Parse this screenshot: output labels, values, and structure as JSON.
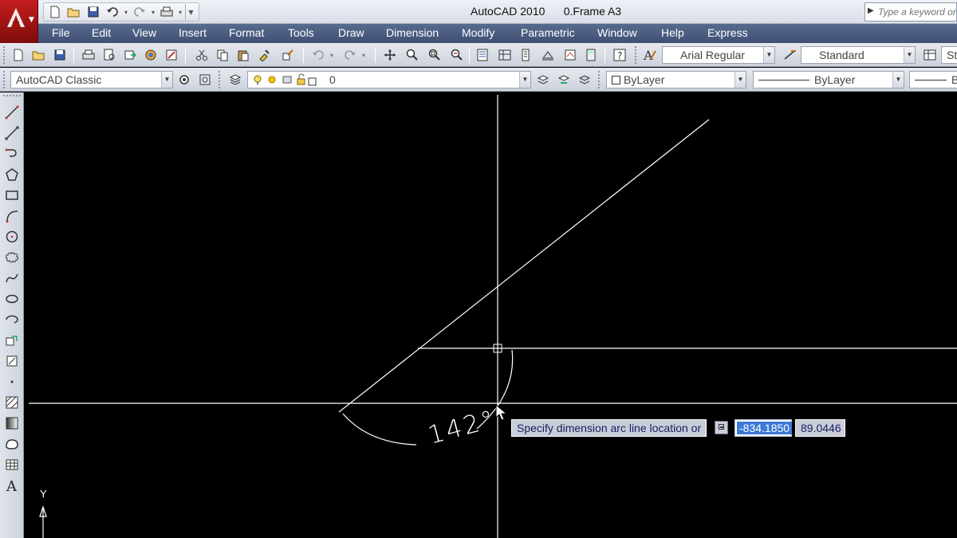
{
  "window": {
    "title": "AutoCAD 2010      0.Frame A3",
    "search_placeholder": "Type a keyword or phrase"
  },
  "menu": {
    "items": [
      "File",
      "Edit",
      "View",
      "Insert",
      "Format",
      "Tools",
      "Draw",
      "Dimension",
      "Modify",
      "Parametric",
      "Window",
      "Help",
      "Express"
    ]
  },
  "toolbar_standard": {
    "text_style": "Arial Regular",
    "dim_style": "Standard",
    "table_style_partial": "St"
  },
  "toolbar_workspace": {
    "workspace": "AutoCAD Classic",
    "layer": "0",
    "color": "ByLayer",
    "linetype": "ByLayer",
    "lineweight_partial": "B"
  },
  "canvas": {
    "dimension_text": "142°",
    "ucs_y_label": "Y"
  },
  "dynamic_input": {
    "prompt": "Specify dimension arc line location or",
    "value_1": "-834.1850",
    "value_2": "89.0446"
  },
  "icons": {
    "app_logo": "autocad-logo-icon",
    "qat": [
      "new-icon",
      "open-icon",
      "save-icon",
      "undo-icon",
      "redo-icon",
      "plot-icon"
    ],
    "draw_toolbar": [
      "line-icon",
      "construction-line-icon",
      "polyline-icon",
      "polygon-icon",
      "rectangle-icon",
      "arc-icon",
      "circle-icon",
      "revision-cloud-icon",
      "spline-icon",
      "ellipse-icon",
      "ellipse-arc-icon",
      "insert-block-icon",
      "make-block-icon",
      "point-icon",
      "hatch-icon",
      "gradient-icon",
      "region-icon",
      "table-icon",
      "multiline-text-icon"
    ]
  },
  "colors": {
    "title_bar": "#dde2ea",
    "menu_bar": "#4b5c80",
    "canvas_bg": "#000000",
    "drawing_lines": "#ffffff",
    "tooltip_bg": "#c9ccd9",
    "selection": "#3d79d6"
  }
}
